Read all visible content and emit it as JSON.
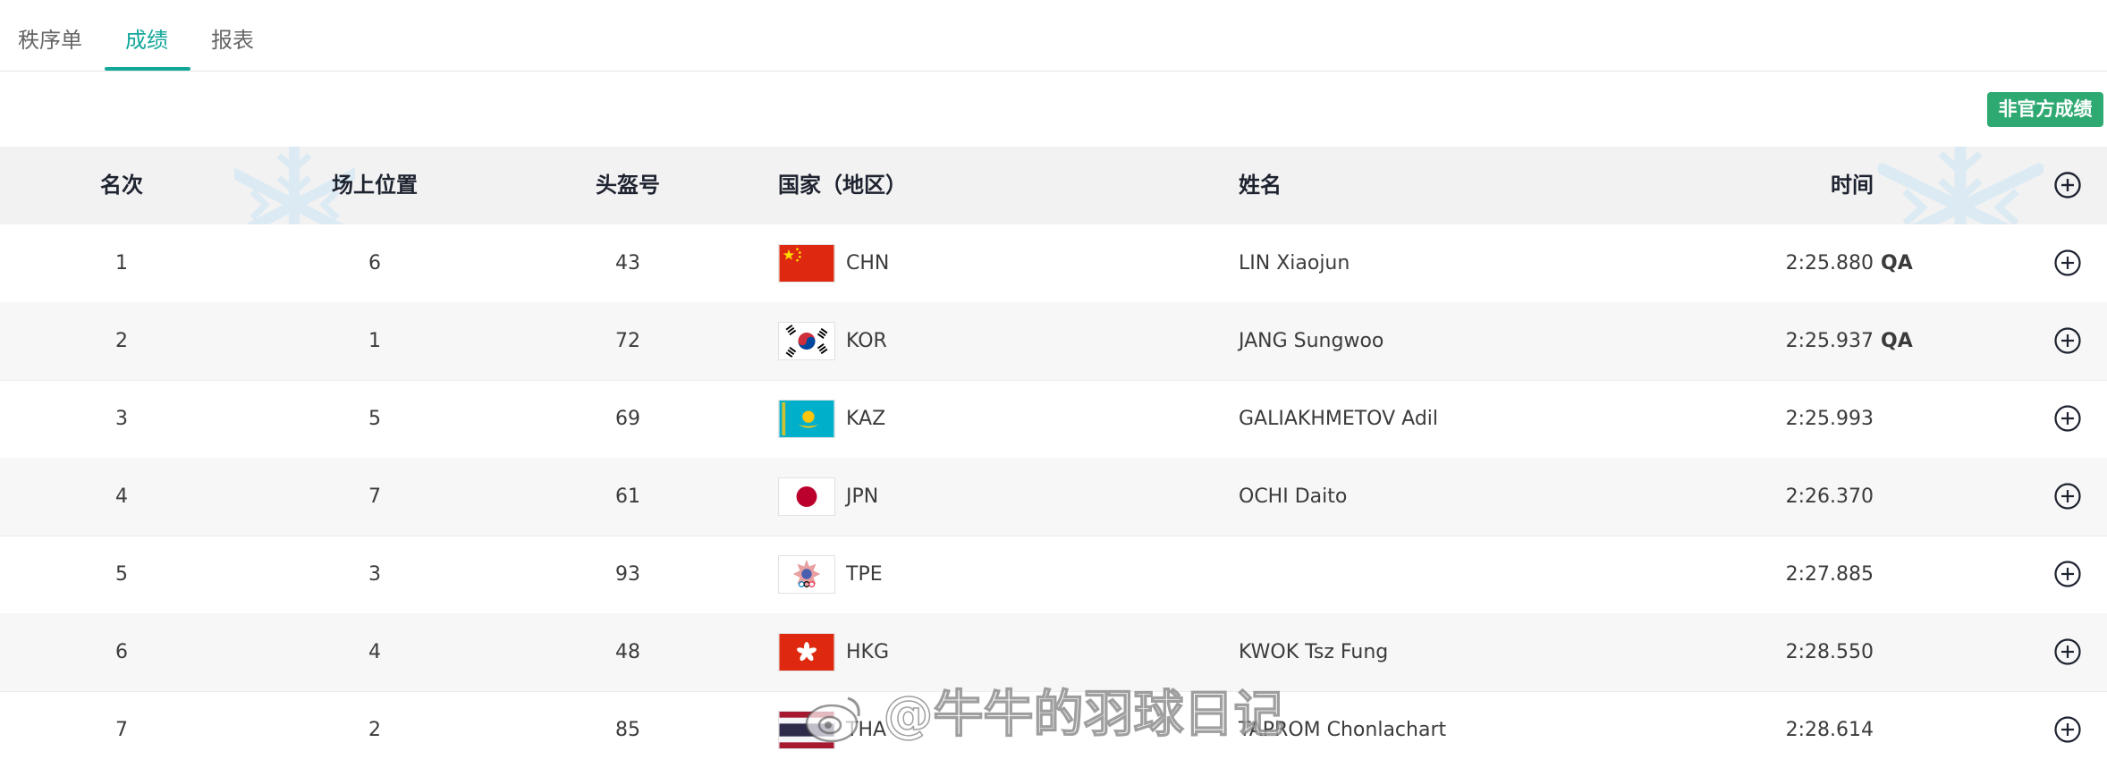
{
  "tabs": [
    {
      "label": "秩序单"
    },
    {
      "label": "成绩"
    },
    {
      "label": "报表"
    }
  ],
  "badge": "非官方成绩",
  "columns": {
    "rank": "名次",
    "position": "场上位置",
    "bib": "头盔号",
    "nation": "国家（地区）",
    "name": "姓名",
    "time": "时间"
  },
  "rows": [
    {
      "rank": "1",
      "position": "6",
      "bib": "43",
      "noc": "CHN",
      "name": "LIN Xiaojun",
      "time": "2:25.880",
      "qual": "QA"
    },
    {
      "rank": "2",
      "position": "1",
      "bib": "72",
      "noc": "KOR",
      "name": "JANG Sungwoo",
      "time": "2:25.937",
      "qual": "QA"
    },
    {
      "rank": "3",
      "position": "5",
      "bib": "69",
      "noc": "KAZ",
      "name": "GALIAKHMETOV Adil",
      "time": "2:25.993",
      "qual": ""
    },
    {
      "rank": "4",
      "position": "7",
      "bib": "61",
      "noc": "JPN",
      "name": "OCHI Daito",
      "time": "2:26.370",
      "qual": ""
    },
    {
      "rank": "5",
      "position": "3",
      "bib": "93",
      "noc": "TPE",
      "name": "",
      "time": "2:27.885",
      "qual": ""
    },
    {
      "rank": "6",
      "position": "4",
      "bib": "48",
      "noc": "HKG",
      "name": "KWOK Tsz Fung",
      "time": "2:28.550",
      "qual": ""
    },
    {
      "rank": "7",
      "position": "2",
      "bib": "85",
      "noc": "THA",
      "name": "TAPROM Chonlachart",
      "time": "2:28.614",
      "qual": ""
    }
  ],
  "watermark": "@牛牛的羽球日记",
  "colors": {
    "accent": "#13a79a",
    "badge": "#2fa972",
    "header_bg": "#f2f2f2"
  }
}
